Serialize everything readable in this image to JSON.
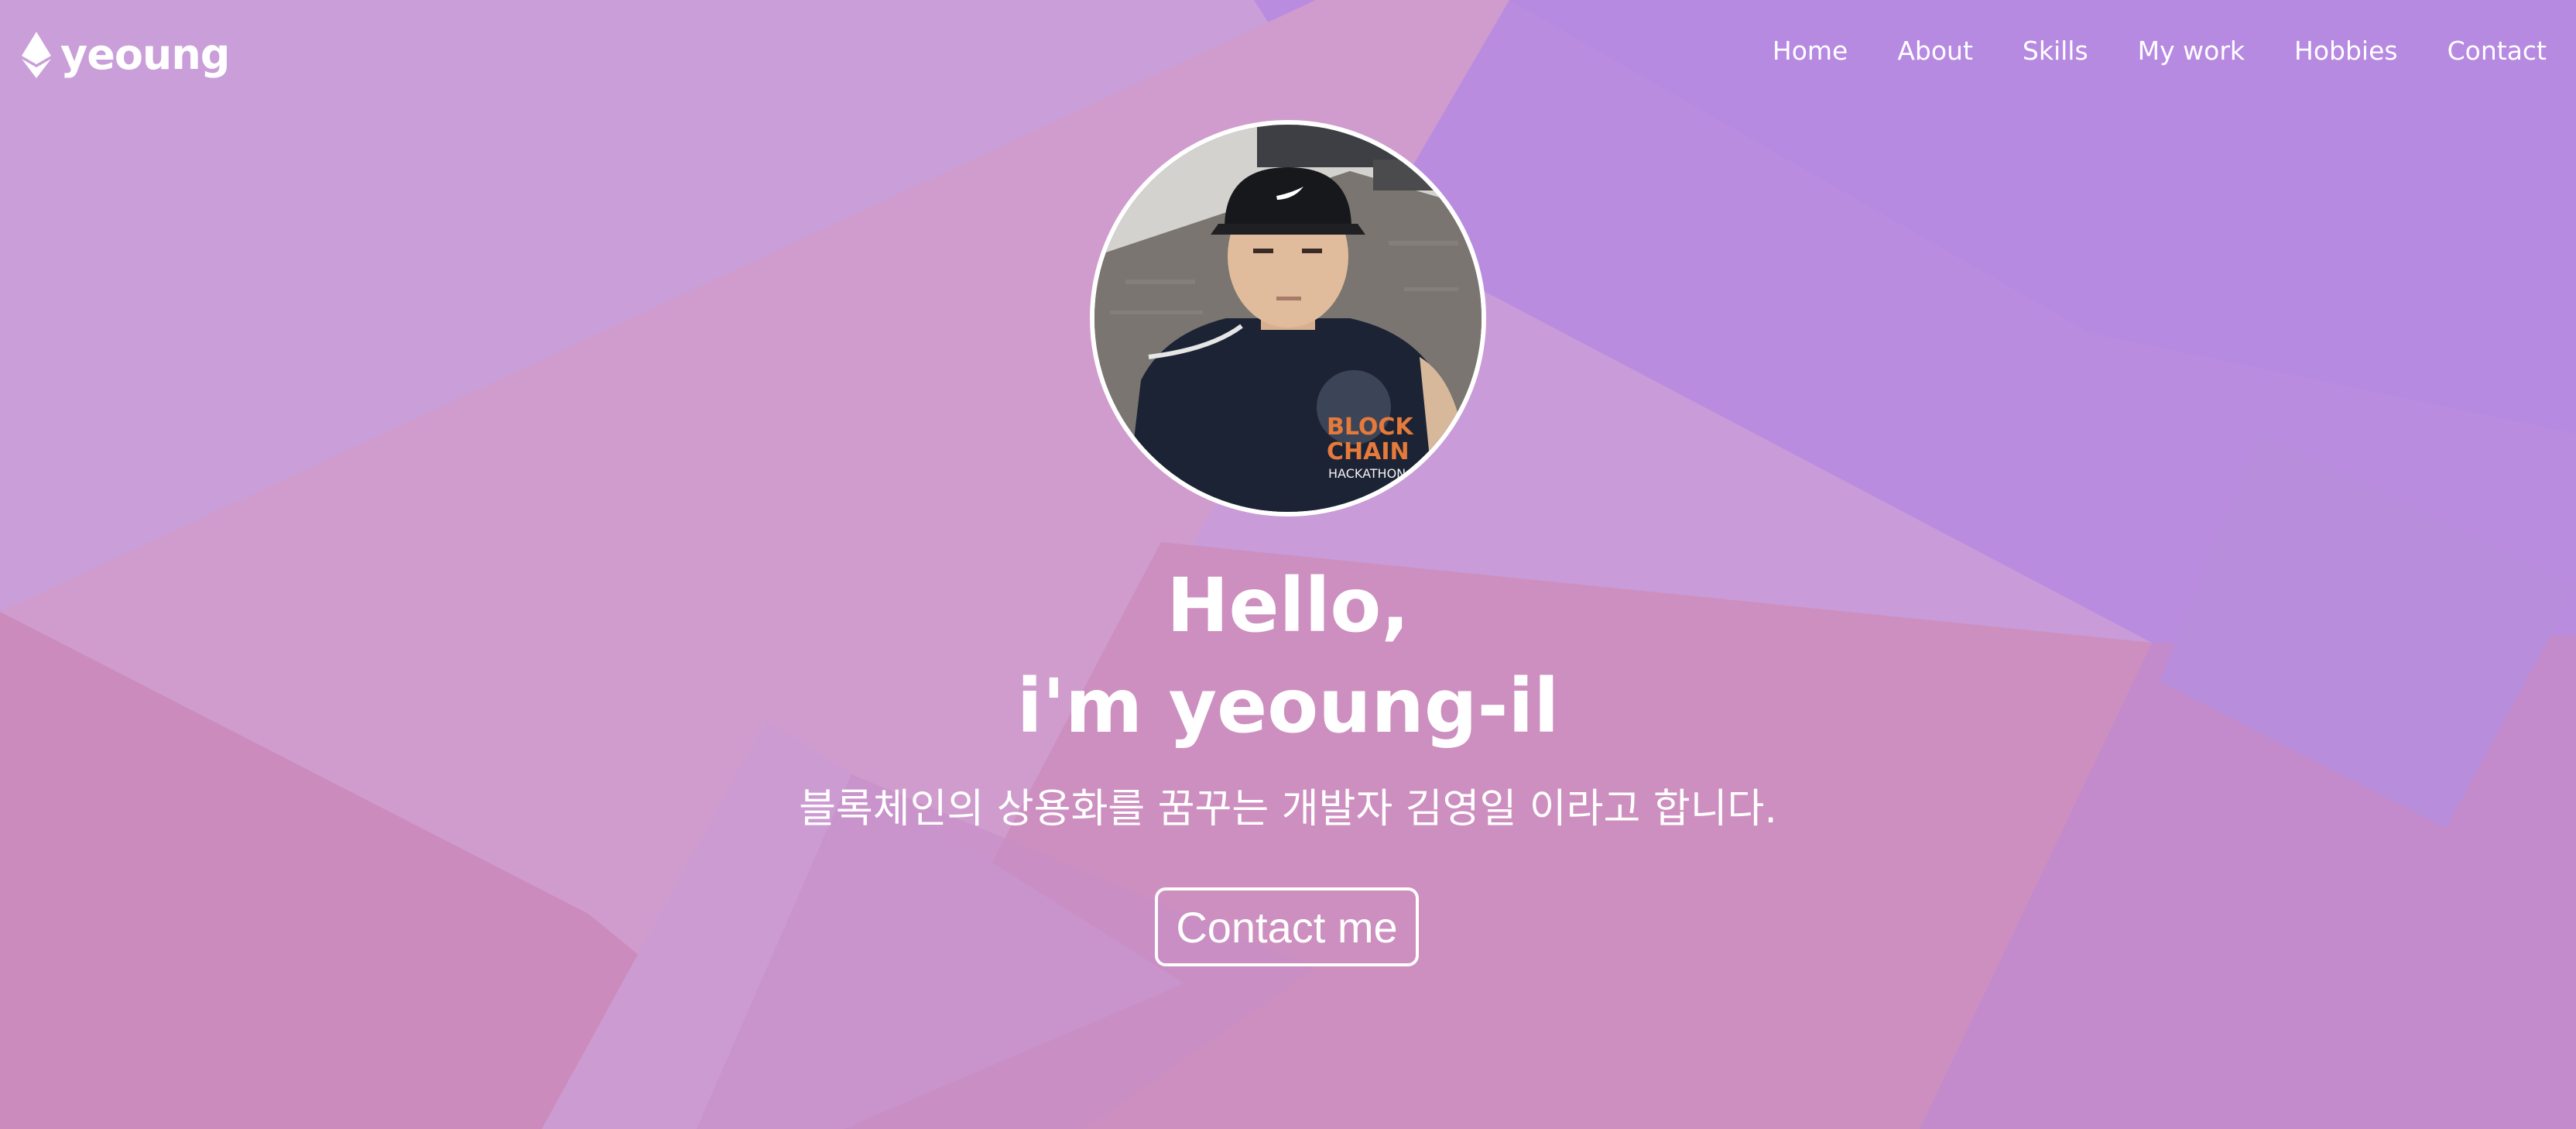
{
  "brand": {
    "name": "yeoung",
    "icon": "ethereum-icon"
  },
  "nav": {
    "items": [
      {
        "label": "Home"
      },
      {
        "label": "About"
      },
      {
        "label": "Skills"
      },
      {
        "label": "My work"
      },
      {
        "label": "Hobbies"
      },
      {
        "label": "Contact"
      }
    ]
  },
  "hero": {
    "avatar_alt": "profile photo",
    "greeting_line1": "Hello,",
    "greeting_line2": "i'm yeoung-il",
    "description": "블록체인의 상용화를 꿈꾸는 개발자 김영일 이라고 합니다.",
    "cta_label": "Contact me",
    "shirt_text": "BLOCK CHAIN HACKATHON"
  },
  "colors": {
    "background_base": "#c996c9",
    "background_pink": "#cf8cb6",
    "background_violet": "#b58de0",
    "text": "#ffffff"
  }
}
